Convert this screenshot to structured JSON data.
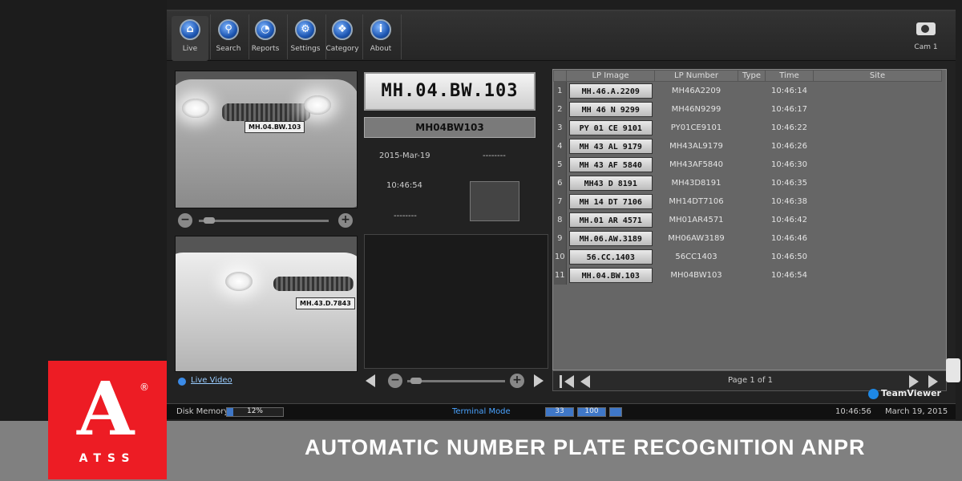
{
  "toolbar": {
    "buttons": [
      {
        "label": "Live",
        "icon": "home-icon"
      },
      {
        "label": "Search",
        "icon": "search-icon"
      },
      {
        "label": "Reports",
        "icon": "reports-icon"
      },
      {
        "label": "Settings",
        "icon": "settings-icon"
      },
      {
        "label": "Category",
        "icon": "category-icon"
      },
      {
        "label": "About",
        "icon": "info-icon"
      }
    ],
    "camera_label": "Cam 1"
  },
  "live_panel": {
    "top_plate": "MH.04.BW.103",
    "bottom_plate": "MH.43.D.7843",
    "live_video_link": "Live Video"
  },
  "detection": {
    "plate_image_text": "MH.04.BW.103",
    "plate_number": "MH04BW103",
    "date": "2015-Mar-19",
    "placeholder_1": "--------",
    "time": "10:46:54",
    "placeholder_2": "--------"
  },
  "table": {
    "columns": [
      "LP Image",
      "LP Number",
      "Type",
      "Time",
      "Site"
    ],
    "rows": [
      {
        "n": "1",
        "img": "MH.46.A.2209",
        "number": "MH46A2209",
        "type": "",
        "time": "10:46:14",
        "site": ""
      },
      {
        "n": "2",
        "img": "MH 46 N 9299",
        "number": "MH46N9299",
        "type": "",
        "time": "10:46:17",
        "site": ""
      },
      {
        "n": "3",
        "img": "PY 01 CE 9101",
        "number": "PY01CE9101",
        "type": "",
        "time": "10:46:22",
        "site": ""
      },
      {
        "n": "4",
        "img": "MH 43 AL 9179",
        "number": "MH43AL9179",
        "type": "",
        "time": "10:46:26",
        "site": ""
      },
      {
        "n": "5",
        "img": "MH 43 AF 5840",
        "number": "MH43AF5840",
        "type": "",
        "time": "10:46:30",
        "site": ""
      },
      {
        "n": "6",
        "img": "MH43 D 8191",
        "number": "MH43D8191",
        "type": "",
        "time": "10:46:35",
        "site": ""
      },
      {
        "n": "7",
        "img": "MH 14 DT 7106",
        "number": "MH14DT7106",
        "type": "",
        "time": "10:46:38",
        "site": ""
      },
      {
        "n": "8",
        "img": "MH.01 AR 4571",
        "number": "MH01AR4571",
        "type": "",
        "time": "10:46:42",
        "site": ""
      },
      {
        "n": "9",
        "img": "MH.06.AW.3189",
        "number": "MH06AW3189",
        "type": "",
        "time": "10:46:46",
        "site": ""
      },
      {
        "n": "10",
        "img": "56.CC.1403",
        "number": "56CC1403",
        "type": "",
        "time": "10:46:50",
        "site": ""
      },
      {
        "n": "11",
        "img": "MH.04.BW.103",
        "number": "MH04BW103",
        "type": "",
        "time": "10:46:54",
        "site": ""
      }
    ],
    "pager_text": "Page 1 of 1"
  },
  "teamviewer": "TeamViewer",
  "status": {
    "disk_label": "Disk Memory",
    "disk_percent": "12%",
    "disk_fraction": 0.12,
    "mode": "Terminal Mode",
    "counter_1": "33",
    "counter_2": "100",
    "time": "10:46:56",
    "date": "March 19, 2015"
  },
  "banner": {
    "title": "AUTOMATIC NUMBER PLATE RECOGNITION ANPR",
    "logo_letter": "A",
    "logo_text": "ATSS",
    "logo_reg": "®"
  },
  "colors": {
    "accent": "#3f77c7",
    "logo_red": "#ed1c24",
    "banner_gray": "#808080"
  }
}
